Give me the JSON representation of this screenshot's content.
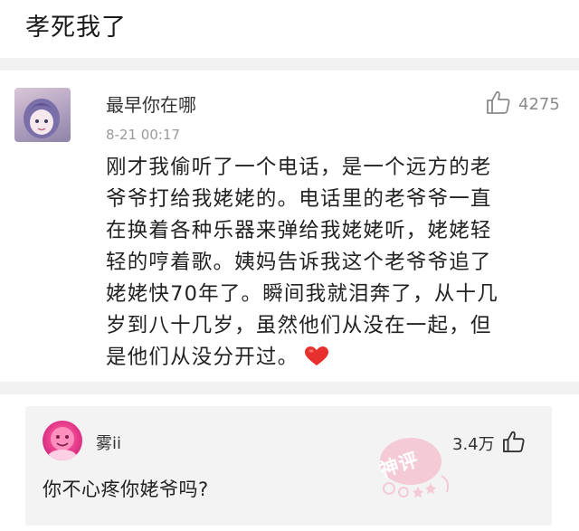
{
  "caption": "孝死我了",
  "comment": {
    "username": "最早你在哪",
    "timestamp": "8-21 00:17",
    "like_count": "4275",
    "text": "刚才我偷听了一个电话，是一个远方的老爷爷打给我姥姥的。电话里的老爷爷一直在换着各种乐器来弹给我姥姥听，姥姥轻轻的哼着歌。姨妈告诉我这个老爷爷追了姥姥快70年了。瞬间我就泪奔了，从十几岁到八十几岁，虽然他们从没在一起，但是他们从没分开过。",
    "text_lines": [
      "刚才我偷听了一个电话，是一个远方的老",
      "爷爷打给我姥姥的。电话里的老爷爷一直",
      "在换着各种乐器来弹给我姥姥听，姥姥轻",
      "轻的哼着歌。姨妈告诉我这个老爷爷追了",
      "姥姥快70年了。瞬间我就泪奔了，从十几",
      "岁到八十几岁，虽然他们从没在一起，但",
      "是他们从没分开过。"
    ]
  },
  "reply": {
    "username": "雾ii",
    "like_count": "3.4万",
    "text": "你不心疼你姥爷吗?",
    "stamp_label": "神评"
  },
  "colors": {
    "band": "#f2f2f2",
    "reply_box": "#f3f3f3",
    "heart": "#e8312f",
    "stamp": "#f3a9bf"
  },
  "icons": {
    "like": "thumbs-up-icon",
    "emoji": "red-heart-icon",
    "stamp": "hot-comment-stamp"
  }
}
